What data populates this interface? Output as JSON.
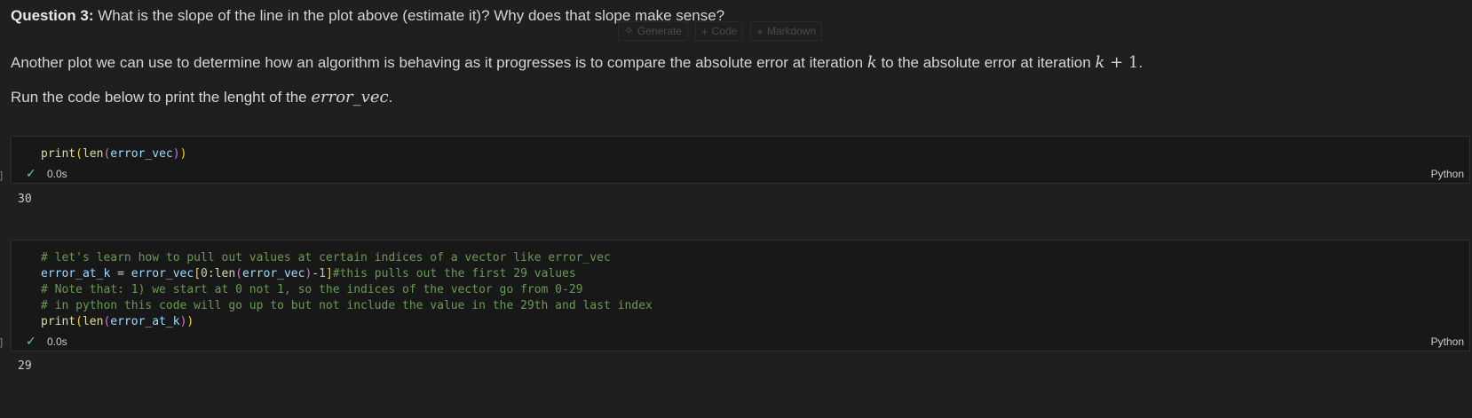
{
  "markdown": {
    "q3_bold": "Question 3:",
    "q3_text": " What is the slope of the line in the plot above (estimate it)? Why does that slope make sense?",
    "para1_a": "Another plot we can use to determine how an algorithm is behaving as it progresses is to compare the absolute error at iteration ",
    "para1_k": "k",
    "para1_b": " to the absolute error at iteration ",
    "para1_k2": "k",
    "para1_plus": " + 1",
    "para1_end": ".",
    "para2_a": "Run the code below to print the lenght of the ",
    "para2_var": "error_vec",
    "para2_end": "."
  },
  "toolbar": {
    "generate": "Generate",
    "code": "Code",
    "markdown": "Markdown"
  },
  "cell1": {
    "t_print": "print",
    "t_op1": "(",
    "t_len": "len",
    "t_op2": "(",
    "t_var": "error_vec",
    "t_cl2": ")",
    "t_cl1": ")",
    "time": "0.0s",
    "lang": "Python",
    "output": "30"
  },
  "cell2": {
    "l1": "# let's learn how to pull out values at certain indices of a vector like error_vec",
    "l2_var": "error_at_k",
    "l2_eq": " = ",
    "l2_vec": "error_vec",
    "l2_b1": "[",
    "l2_zero": "0",
    "l2_colon": ":",
    "l2_len": "len",
    "l2_p": "(",
    "l2_vec2": "error_vec",
    "l2_pc": ")",
    "l2_minus": "-",
    "l2_one": "1",
    "l2_b2": "]",
    "l2_cmt": "#this pulls out the first 29 values",
    "l3": "# Note that: 1) we start at 0 not 1, so the indices of the vector go from 0-29",
    "l4": "# in python this code will go up to but not include the value in the 29th and last index",
    "l5_print": "print",
    "l5_o1": "(",
    "l5_len": "len",
    "l5_o2": "(",
    "l5_var": "error_at_k",
    "l5_c2": ")",
    "l5_c1": ")",
    "time": "0.0s",
    "lang": "Python",
    "output": "29"
  },
  "colors": {
    "background": "#1f1f1f",
    "cell_bg": "#181818",
    "success": "#73c991"
  }
}
